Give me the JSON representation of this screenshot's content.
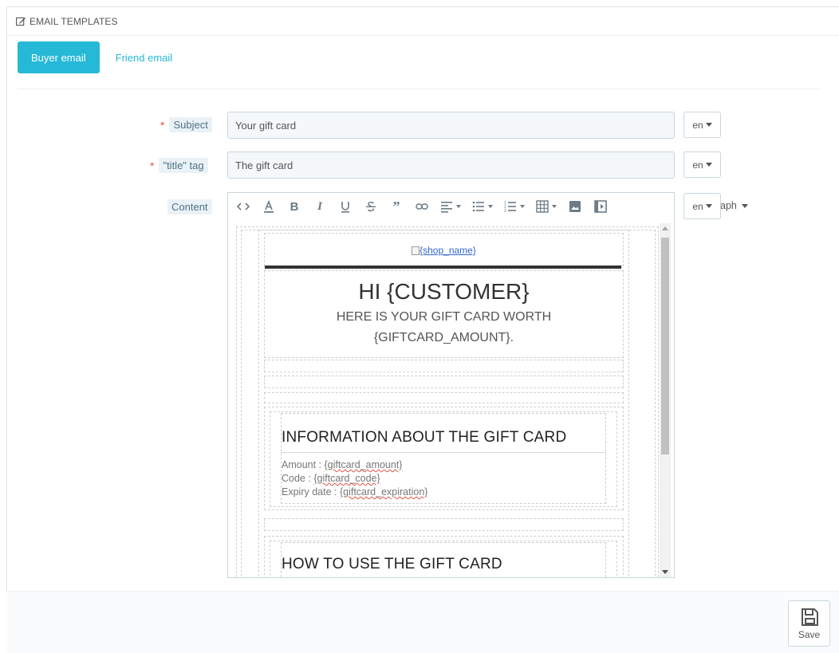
{
  "panel": {
    "title": "EMAIL TEMPLATES",
    "icon": "edit-icon"
  },
  "tabs": [
    {
      "label": "Buyer email",
      "active": true
    },
    {
      "label": "Friend email",
      "active": false
    }
  ],
  "fields": {
    "subject": {
      "label": "Subject",
      "required": true,
      "value": "Your gift card",
      "lang": "en"
    },
    "title_tag": {
      "label": "\"title\" tag",
      "required": true,
      "value": "The gift card",
      "lang": "en"
    },
    "content": {
      "label": "Content",
      "lang": "en",
      "format_overflow": "aph"
    }
  },
  "toolbar": {
    "buttons": [
      "code-view",
      "text-color",
      "bold",
      "italic",
      "underline",
      "strikethrough",
      "blockquote",
      "link",
      "align",
      "bullet-list",
      "numbered-list",
      "table",
      "image",
      "media"
    ]
  },
  "email": {
    "shop_link": "{shop_name}",
    "greeting": "HI {CUSTOMER}",
    "worth_line1": "HERE IS YOUR GIFT CARD WORTH",
    "worth_line2": "{GIFTCARD_AMOUNT}.",
    "info_title": "INFORMATION ABOUT THE GIFT CARD",
    "amount_label": "Amount : ",
    "amount_var": "{giftcard_amount}",
    "code_label": "Code : ",
    "code_var": "{giftcard_code}",
    "expiry_label": "Expiry date : ",
    "expiry_var": "{giftcard_expiration}",
    "howto_title": "HOW TO USE THE GIFT CARD"
  },
  "save": {
    "label": "Save"
  },
  "colors": {
    "accent": "#25b9d7",
    "required": "#e15344",
    "label_bg": "#eaf2f7"
  }
}
